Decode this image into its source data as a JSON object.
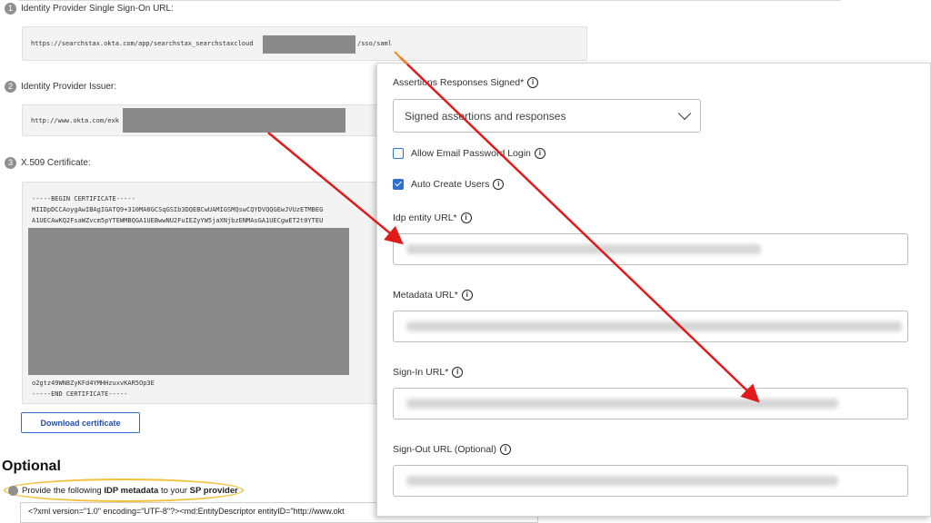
{
  "steps": [
    {
      "num": "1",
      "label": "Identity Provider Single Sign-On URL:",
      "value_start": "https://searchstax.okta.com/app/searchstax_searchstaxcloud",
      "value_end": "/sso/saml"
    },
    {
      "num": "2",
      "label": "Identity Provider Issuer:",
      "value_start": "http://www.okta.com/exk"
    },
    {
      "num": "3",
      "label": "X.509 Certificate:",
      "cert_lines": [
        "-----BEGIN CERTIFICATE-----",
        "MIIDpDCCAoygAwIBAgIGATQ9+310MA0GCSqGSIb3DQEBCwUAMIGSMQswCQYDVQQGEwJVUzETMBEG",
        "A1UECAwKQ2FsaWZvcm5pYTEWMBQGA1UEBwwNU2FuIEZyYW5jaXNjbzENMAsGA1UECgwET2t0YTEU"
      ],
      "cert_tail": [
        "o2gtz49WN8ZyKFd4YMHHzuxvKAR5Op3E",
        "-----END CERTIFICATE-----"
      ]
    }
  ],
  "download_label": "Download certificate",
  "optional": {
    "title": "Optional",
    "provide_pre": "Provide the following ",
    "provide_b1": "IDP metadata",
    "provide_mid": " to your ",
    "provide_b2": "SP provider",
    "xml": "<?xml version=\"1.0\" encoding=\"UTF-8\"?><md:EntityDescriptor entityID=\"http://www.okt"
  },
  "panel": {
    "assertions_label": "Assertions Responses Signed*",
    "assertions_value": "Signed assertions and responses",
    "allow_email_label": "Allow Email Password Login",
    "allow_email_checked": false,
    "auto_create_label": "Auto Create Users",
    "auto_create_checked": true,
    "idp_entity_label": "Idp entity URL*",
    "metadata_label": "Metadata URL*",
    "signin_label": "Sign-In URL*",
    "signout_label": "Sign-Out URL (Optional)"
  },
  "icons": {
    "info": "info-circle-icon",
    "chevron": "chevron-down-icon",
    "arrow": "red-arrow-annotation"
  },
  "colors": {
    "accent": "#2f6fd1",
    "arrow_red": "#e01b1b",
    "highlight": "#f0c240",
    "orange_arrow": "#f08a24"
  }
}
